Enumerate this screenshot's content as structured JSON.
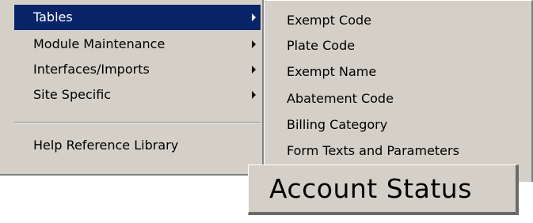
{
  "main_menu": {
    "items": [
      {
        "label": "Tables",
        "has_submenu": true,
        "active": true
      },
      {
        "label": "Module Maintenance",
        "has_submenu": true,
        "active": false
      },
      {
        "label": "Interfaces/Imports",
        "has_submenu": true,
        "active": false
      },
      {
        "label": "Site Specific",
        "has_submenu": true,
        "active": false
      },
      {
        "label": "Help Reference Library",
        "has_submenu": false,
        "active": false
      }
    ]
  },
  "submenu": {
    "items": [
      {
        "label": "Exempt Code"
      },
      {
        "label": "Plate Code"
      },
      {
        "label": "Exempt Name"
      },
      {
        "label": "Abatement Code"
      },
      {
        "label": "Billing Category"
      },
      {
        "label": "Form Texts and Parameters"
      }
    ]
  },
  "zoom_callout": {
    "label": "Account Status"
  },
  "colors": {
    "menu_background": "#d4d0c8",
    "highlight_background": "#0a246a",
    "highlight_text": "#ffffff",
    "text": "#000000",
    "shadow": "#808080"
  },
  "icons": {
    "submenu_arrow": "chevron-right-icon"
  }
}
